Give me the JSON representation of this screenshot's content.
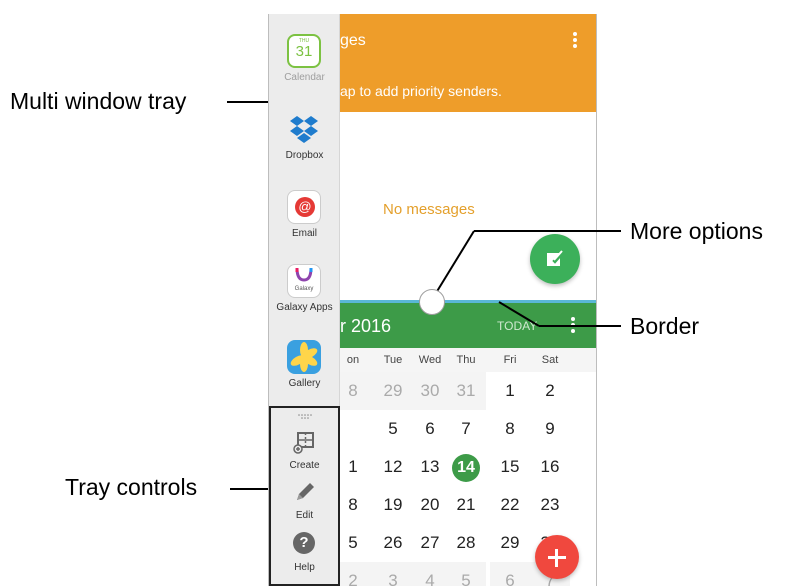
{
  "annotations": {
    "multi_window_tray": "Multi window tray",
    "tray_controls": "Tray controls",
    "more_options": "More options",
    "border": "Border"
  },
  "email_app": {
    "title": "ges",
    "hint": "ap to add priority senders.",
    "empty_text": "No messages",
    "more_icon": "more-vertical-icon",
    "compose_icon": "compose-icon",
    "header_color": "#ee9d2a",
    "fab_color": "#3cb05a"
  },
  "calendar_app": {
    "month_title": "r 2016",
    "today_label": "TODAY",
    "header_color": "#3d9b48",
    "weekdays": [
      "on",
      "Tue",
      "Wed",
      "Thu",
      "Fri",
      "Sat"
    ],
    "weeks": [
      [
        {
          "d": "8",
          "other": true
        },
        {
          "d": "29",
          "other": true
        },
        {
          "d": "30",
          "other": true
        },
        {
          "d": "31",
          "other": true
        },
        {
          "d": "1"
        },
        {
          "d": "2"
        }
      ],
      [
        {
          "d": ""
        },
        {
          "d": "5"
        },
        {
          "d": "6"
        },
        {
          "d": "7"
        },
        {
          "d": "8"
        },
        {
          "d": "9"
        }
      ],
      [
        {
          "d": "1"
        },
        {
          "d": "12"
        },
        {
          "d": "13"
        },
        {
          "d": "14",
          "today": true
        },
        {
          "d": "15"
        },
        {
          "d": "16"
        }
      ],
      [
        {
          "d": "8"
        },
        {
          "d": "19"
        },
        {
          "d": "20"
        },
        {
          "d": "21"
        },
        {
          "d": "22"
        },
        {
          "d": "23"
        }
      ],
      [
        {
          "d": "5"
        },
        {
          "d": "26"
        },
        {
          "d": "27"
        },
        {
          "d": "28"
        },
        {
          "d": "29"
        },
        {
          "d": "30"
        }
      ],
      [
        {
          "d": "2",
          "other": true
        },
        {
          "d": "3",
          "other": true
        },
        {
          "d": "4",
          "other": true
        },
        {
          "d": "5",
          "other": true
        },
        {
          "d": "6",
          "other": true
        },
        {
          "d": "7",
          "other": true
        }
      ]
    ],
    "add_icon": "plus-icon",
    "add_color": "#f0483e"
  },
  "tray": {
    "apps": [
      {
        "label": "Calendar",
        "icon": "calendar-icon",
        "icon_text": "31",
        "icon_small": "THU"
      },
      {
        "label": "Dropbox",
        "icon": "dropbox-icon"
      },
      {
        "label": "Email",
        "icon": "email-icon",
        "icon_text": "@"
      },
      {
        "label": "Galaxy Apps",
        "icon": "galaxy-apps-icon",
        "icon_text": "Galaxy"
      },
      {
        "label": "Gallery",
        "icon": "gallery-icon"
      }
    ],
    "controls": [
      {
        "label": "Create",
        "icon": "create-icon"
      },
      {
        "label": "Edit",
        "icon": "pencil-icon"
      },
      {
        "label": "Help",
        "icon": "help-icon",
        "icon_text": "?"
      }
    ]
  }
}
